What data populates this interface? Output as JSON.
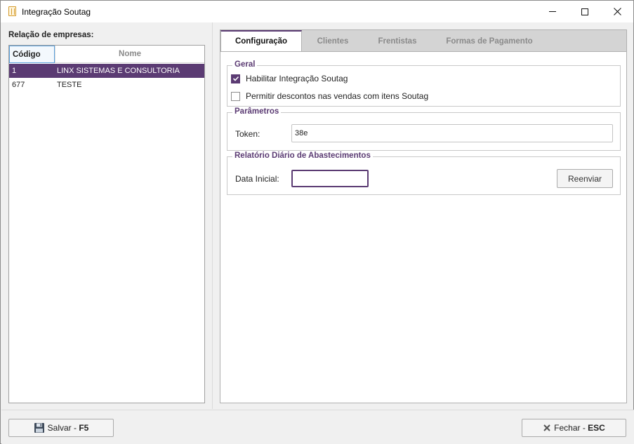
{
  "window": {
    "title": "Integração Soutag"
  },
  "left": {
    "label": "Relação de empresas:",
    "columns": {
      "codigo": "Código",
      "nome": "Nome"
    },
    "rows": [
      {
        "codigo": "1",
        "nome": "LINX SISTEMAS E CONSULTORIA",
        "selected": true
      },
      {
        "codigo": "677",
        "nome": "TESTE",
        "selected": false
      }
    ]
  },
  "tabs": [
    {
      "label": "Configuração",
      "active": true
    },
    {
      "label": "Clientes",
      "active": false
    },
    {
      "label": "Frentistas",
      "active": false
    },
    {
      "label": "Formas de Pagamento",
      "active": false
    }
  ],
  "config": {
    "geral": {
      "title": "Geral",
      "habilitar": {
        "label": "Habilitar Integração Soutag",
        "checked": true
      },
      "permitir": {
        "label": "Permitir descontos nas vendas com itens Soutag",
        "checked": false
      }
    },
    "parametros": {
      "title": "Parâmetros",
      "token_label": "Token:",
      "token_value": "38e"
    },
    "relatorio": {
      "title": "Relatório Diário de Abastecimentos",
      "data_label": "Data Inicial:",
      "data_value": "",
      "reenviar_label": "Reenviar"
    }
  },
  "footer": {
    "save_label": "Salvar - ",
    "save_key": "F5",
    "close_label": "Fechar - ",
    "close_key": "ESC"
  },
  "colors": {
    "accent": "#5b3b73",
    "selection": "#5b3b73"
  }
}
